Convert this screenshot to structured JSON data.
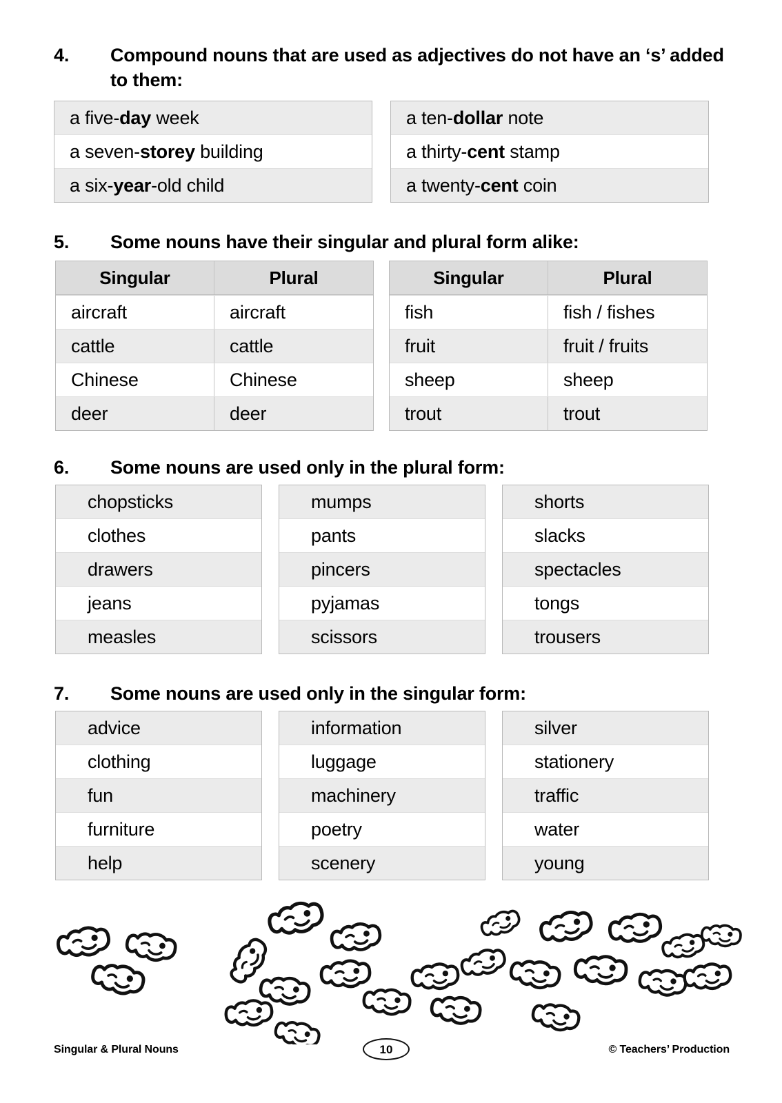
{
  "sections": [
    {
      "number": "4.",
      "title": "Compound nouns that are used as adjectives do not have an ‘s’ added to them:",
      "layout": "two-lists",
      "lists": [
        [
          {
            "pre": "a five-",
            "bold": "day",
            "post": " week"
          },
          {
            "pre": "a seven-",
            "bold": "storey",
            "post": " building"
          },
          {
            "pre": "a six-",
            "bold": "year",
            "post": "-old child"
          }
        ],
        [
          {
            "pre": "a ten-",
            "bold": "dollar",
            "post": " note"
          },
          {
            "pre": "a thirty-",
            "bold": "cent",
            "post": " stamp"
          },
          {
            "pre": "a twenty-",
            "bold": "cent",
            "post": " coin"
          }
        ]
      ]
    },
    {
      "number": "5.",
      "title": "Some nouns have their singular and plural form alike:",
      "layout": "two-tables",
      "headers": [
        "Singular",
        "Plural"
      ],
      "tables": [
        [
          [
            "aircraft",
            "aircraft"
          ],
          [
            "cattle",
            "cattle"
          ],
          [
            "Chinese",
            "Chinese"
          ],
          [
            "deer",
            "deer"
          ]
        ],
        [
          [
            "fish",
            "fish /  fishes"
          ],
          [
            "fruit",
            "fruit / fruits"
          ],
          [
            "sheep",
            "sheep"
          ],
          [
            "trout",
            "trout"
          ]
        ]
      ]
    },
    {
      "number": "6.",
      "title": "Some nouns are used only in the plural form:",
      "layout": "three-lists",
      "columns": [
        [
          "chopsticks",
          "clothes",
          "drawers",
          "jeans",
          "measles"
        ],
        [
          "mumps",
          "pants",
          "pincers",
          "pyjamas",
          "scissors"
        ],
        [
          "shorts",
          "slacks",
          "spectacles",
          "tongs",
          "trousers"
        ]
      ]
    },
    {
      "number": "7.",
      "title": "Some nouns are used only in the singular form:",
      "layout": "three-lists",
      "columns": [
        [
          "advice",
          "clothing",
          "fun",
          "furniture",
          "help"
        ],
        [
          "information",
          "luggage",
          "machinery",
          "poetry",
          "scenery"
        ],
        [
          "silver",
          "stationery",
          "traffic",
          "water",
          "young"
        ]
      ]
    }
  ],
  "illustration": {
    "name": "school-of-fish",
    "description": "Hand-drawn cartoon goldfish outlines scattered across the bottom of the page",
    "fish_count": 24
  },
  "footer": {
    "left": "Singular & Plural Nouns",
    "page_number": "10",
    "right": "© Teachers’ Production"
  },
  "colors": {
    "shade": "#ebebeb",
    "header_shade": "#dcdcdc",
    "border": "#b9b9b9",
    "text": "#000000"
  }
}
